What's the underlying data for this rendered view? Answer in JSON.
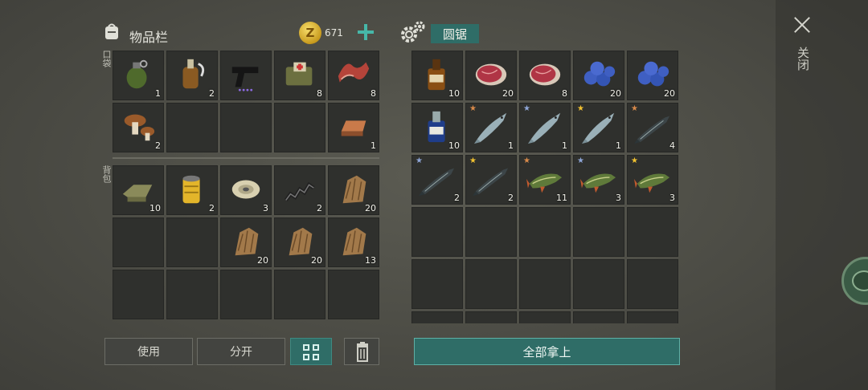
{
  "inventory": {
    "title": "物品栏",
    "coins": "671",
    "pocket_label": "口袋",
    "backpack_label": "背包",
    "pocket_slots": [
      {
        "icon": "grenade-icon",
        "count": "1"
      },
      {
        "icon": "bottle-molotov-icon",
        "count": "2"
      },
      {
        "icon": "pistol-icon",
        "count": ""
      },
      {
        "icon": "medkit-bag-icon",
        "count": "8"
      },
      {
        "icon": "bacon-icon",
        "count": "8"
      },
      {
        "icon": "mushroom-icon",
        "count": "2"
      },
      {
        "icon": "",
        "count": ""
      },
      {
        "icon": "",
        "count": ""
      },
      {
        "icon": "",
        "count": ""
      },
      {
        "icon": "copper-ingot-icon",
        "count": "1"
      }
    ],
    "backpack_slots": [
      {
        "icon": "cloth-icon",
        "count": "10"
      },
      {
        "icon": "oil-filter-icon",
        "count": "2"
      },
      {
        "icon": "wire-spool-icon",
        "count": "3"
      },
      {
        "icon": "spring-icon",
        "count": "2"
      },
      {
        "icon": "fur-icon",
        "count": "20"
      },
      {
        "icon": "",
        "count": ""
      },
      {
        "icon": "",
        "count": ""
      },
      {
        "icon": "fur-icon",
        "count": "20"
      },
      {
        "icon": "fur-icon",
        "count": "20"
      },
      {
        "icon": "fur-icon",
        "count": "13"
      },
      {
        "icon": "",
        "count": ""
      },
      {
        "icon": "",
        "count": ""
      },
      {
        "icon": "",
        "count": ""
      },
      {
        "icon": "",
        "count": ""
      },
      {
        "icon": "",
        "count": ""
      }
    ],
    "buttons": {
      "use": "使用",
      "split": "分开"
    }
  },
  "container": {
    "title": "圆锯",
    "take_all": "全部拿上",
    "slots": [
      {
        "icon": "whiskey-bottle-icon",
        "count": "10",
        "star": ""
      },
      {
        "icon": "raw-steak-icon",
        "count": "20",
        "star": ""
      },
      {
        "icon": "raw-steak-icon",
        "count": "8",
        "star": ""
      },
      {
        "icon": "blueberries-icon",
        "count": "20",
        "star": ""
      },
      {
        "icon": "blueberries-icon",
        "count": "20",
        "star": ""
      },
      {
        "icon": "medicine-bottle-icon",
        "count": "10",
        "star": ""
      },
      {
        "icon": "salmon-icon",
        "count": "1",
        "star": "bronze"
      },
      {
        "icon": "salmon-icon",
        "count": "1",
        "star": "silver"
      },
      {
        "icon": "salmon-icon",
        "count": "1",
        "star": "gold"
      },
      {
        "icon": "sturgeon-icon",
        "count": "4",
        "star": "bronze"
      },
      {
        "icon": "sturgeon-icon",
        "count": "2",
        "star": "silver"
      },
      {
        "icon": "sturgeon-icon",
        "count": "2",
        "star": "gold"
      },
      {
        "icon": "pike-icon",
        "count": "11",
        "star": "bronze"
      },
      {
        "icon": "pike-icon",
        "count": "3",
        "star": "silver"
      },
      {
        "icon": "pike-icon",
        "count": "3",
        "star": "gold"
      },
      {
        "icon": "",
        "count": "",
        "star": ""
      },
      {
        "icon": "",
        "count": "",
        "star": ""
      },
      {
        "icon": "",
        "count": "",
        "star": ""
      },
      {
        "icon": "",
        "count": "",
        "star": ""
      },
      {
        "icon": "",
        "count": "",
        "star": ""
      },
      {
        "icon": "",
        "count": "",
        "star": ""
      },
      {
        "icon": "",
        "count": "",
        "star": ""
      },
      {
        "icon": "",
        "count": "",
        "star": ""
      },
      {
        "icon": "",
        "count": "",
        "star": ""
      },
      {
        "icon": "",
        "count": "",
        "star": ""
      },
      {
        "icon": "",
        "count": "",
        "star": ""
      },
      {
        "icon": "",
        "count": "",
        "star": ""
      },
      {
        "icon": "",
        "count": "",
        "star": ""
      },
      {
        "icon": "",
        "count": "",
        "star": ""
      },
      {
        "icon": "",
        "count": "",
        "star": ""
      }
    ]
  },
  "close_label": "关闭",
  "colors": {
    "accent": "#2f6d67",
    "plus": "#46b7a8",
    "bronze": "#d98a4a",
    "silver": "#8fa6d8",
    "gold": "#f2c230"
  }
}
